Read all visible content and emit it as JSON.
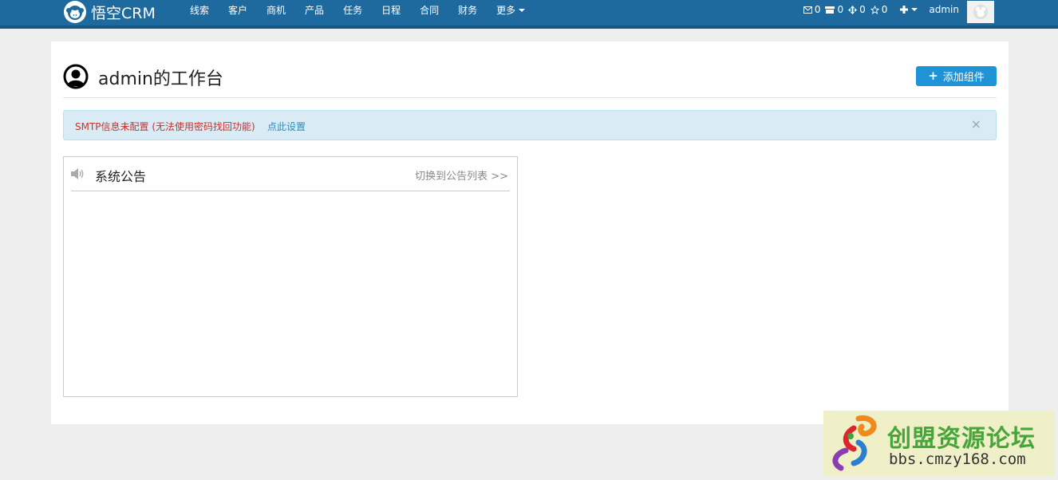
{
  "brand": {
    "name": "悟空CRM",
    "logo_icon": "monkey-logo-icon"
  },
  "nav": {
    "items": [
      "线索",
      "客户",
      "商机",
      "产品",
      "任务",
      "日程",
      "合同",
      "财务"
    ],
    "more_label": "更多"
  },
  "counters": [
    {
      "icon": "envelope-icon",
      "value": "0"
    },
    {
      "icon": "inbox-icon",
      "value": "0"
    },
    {
      "icon": "move-icon",
      "value": "0"
    },
    {
      "icon": "star-icon",
      "value": "0"
    }
  ],
  "user": {
    "name": "admin"
  },
  "page": {
    "title": "admin的工作台",
    "add_widget_label": "添加组件"
  },
  "alert": {
    "message": "SMTP信息未配置 (无法使用密码找回功能)",
    "link_label": "点此设置",
    "close_label": "×"
  },
  "notice": {
    "title": "系统公告",
    "switch_label": "切换到公告列表 >>"
  },
  "watermark": {
    "title": "创盟资源论坛",
    "url": "bbs.cmzy168.com"
  },
  "colors": {
    "navbar": "#1e6a9e",
    "primary_button": "#1e93d6",
    "alert_bg": "#d9ecf6",
    "alert_text": "#c9302c",
    "link": "#2a8dbd"
  }
}
